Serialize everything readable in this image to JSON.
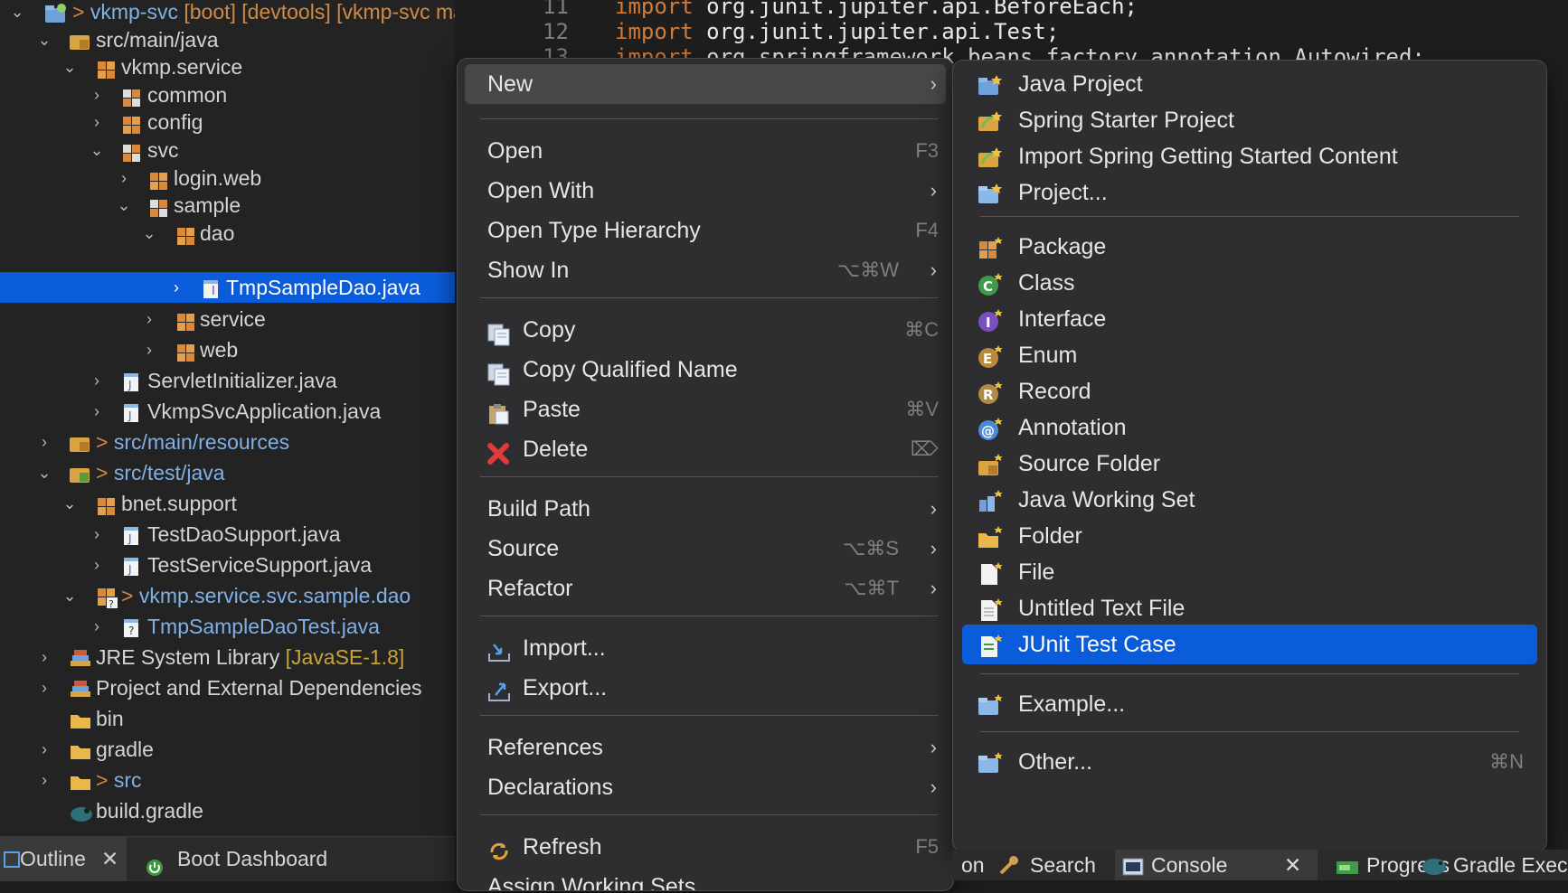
{
  "tree": {
    "rows": [
      {
        "prefix": "> ",
        "label": "vkmp-svc",
        "suffix": " [boot] [devtools] [vkmp-svc main]",
        "chev": "v"
      },
      {
        "label": "src/main/java",
        "chev": "v"
      },
      {
        "label": "vkmp.service",
        "chev": "v"
      },
      {
        "label": "common",
        "chev": ">"
      },
      {
        "label": "config",
        "chev": ">"
      },
      {
        "label": "svc",
        "chev": "v"
      },
      {
        "label": "login.web",
        "chev": ">"
      },
      {
        "label": "sample",
        "chev": "v"
      },
      {
        "label": "dao",
        "chev": "v"
      },
      {
        "label": "TmpSampleDao.java",
        "chev": ">"
      },
      {
        "label": "service",
        "chev": ">"
      },
      {
        "label": "web",
        "chev": ">"
      },
      {
        "label": "ServletInitializer.java",
        "chev": ">"
      },
      {
        "label": "VkmpSvcApplication.java",
        "chev": ">"
      },
      {
        "prefix": "> ",
        "label": "src/main/resources",
        "chev": ">"
      },
      {
        "prefix": "> ",
        "label": "src/test/java",
        "chev": "v"
      },
      {
        "label": "bnet.support",
        "chev": "v"
      },
      {
        "label": "TestDaoSupport.java",
        "chev": ">"
      },
      {
        "label": "TestServiceSupport.java",
        "chev": ">"
      },
      {
        "prefix": "> ",
        "label": "vkmp.service.svc.sample.dao",
        "chev": "v"
      },
      {
        "label": "TmpSampleDaoTest.java",
        "chev": ">"
      },
      {
        "label": "JRE System Library",
        "suffix": " [JavaSE-1.8]",
        "chev": ">"
      },
      {
        "label": "Project and External Dependencies",
        "chev": ">"
      },
      {
        "label": "bin",
        "chev": ""
      },
      {
        "label": "gradle",
        "chev": ">"
      },
      {
        "prefix": "> ",
        "label": "src",
        "chev": ">"
      },
      {
        "label": "build.gradle",
        "chev": ""
      }
    ],
    "tabs": {
      "outline": "Outline",
      "close": "✕",
      "boot": "Boot Dashboard"
    }
  },
  "editor": {
    "lines": [
      {
        "num": "11",
        "kw": "import",
        "code": " org.junit.jupiter.api.BeforeEach;"
      },
      {
        "num": "12",
        "kw": "import",
        "code": " org.junit.jupiter.api.Test;"
      },
      {
        "num": "13",
        "kw": "import",
        "code": " org.springframework.beans.factory.annotation.Autowired;"
      }
    ]
  },
  "context_menu": {
    "new": "New",
    "open": "Open",
    "open_sc": "F3",
    "open_with": "Open With",
    "open_type_hierarchy": "Open Type Hierarchy",
    "oth_sc": "F4",
    "show_in": "Show In",
    "show_in_sc": "⌥⌘W",
    "copy": "Copy",
    "copy_sc": "⌘C",
    "copy_qualified": "Copy Qualified Name",
    "paste": "Paste",
    "paste_sc": "⌘V",
    "delete": "Delete",
    "delete_sc": "⌦",
    "build_path": "Build Path",
    "source": "Source",
    "source_sc": "⌥⌘S",
    "refactor": "Refactor",
    "refactor_sc": "⌥⌘T",
    "import": "Import...",
    "export": "Export...",
    "references": "References",
    "declarations": "Declarations",
    "refresh": "Refresh",
    "refresh_sc": "F5",
    "assign_working_sets": "Assign Working Sets..."
  },
  "submenu": {
    "java_project": "Java Project",
    "spring_starter": "Spring Starter Project",
    "import_spring": "Import Spring Getting Started Content",
    "project": "Project...",
    "package": "Package",
    "class": "Class",
    "interface": "Interface",
    "enum": "Enum",
    "record": "Record",
    "annotation": "Annotation",
    "source_folder": "Source Folder",
    "java_working_set": "Java Working Set",
    "folder": "Folder",
    "file": "File",
    "untitled_text": "Untitled Text File",
    "junit": "JUnit Test Case",
    "example": "Example...",
    "other": "Other...",
    "other_sc": "⌘N"
  },
  "bottom_tabs": {
    "on": "on",
    "search": "Search",
    "console": "Console",
    "close": "✕",
    "progress": "Progress",
    "gradle": "Gradle Exec"
  },
  "colors": {
    "selection": "#0a5cdb",
    "keyword": "#d47a3b",
    "prefix": "#d08a45",
    "link": "#7fb0e6"
  }
}
